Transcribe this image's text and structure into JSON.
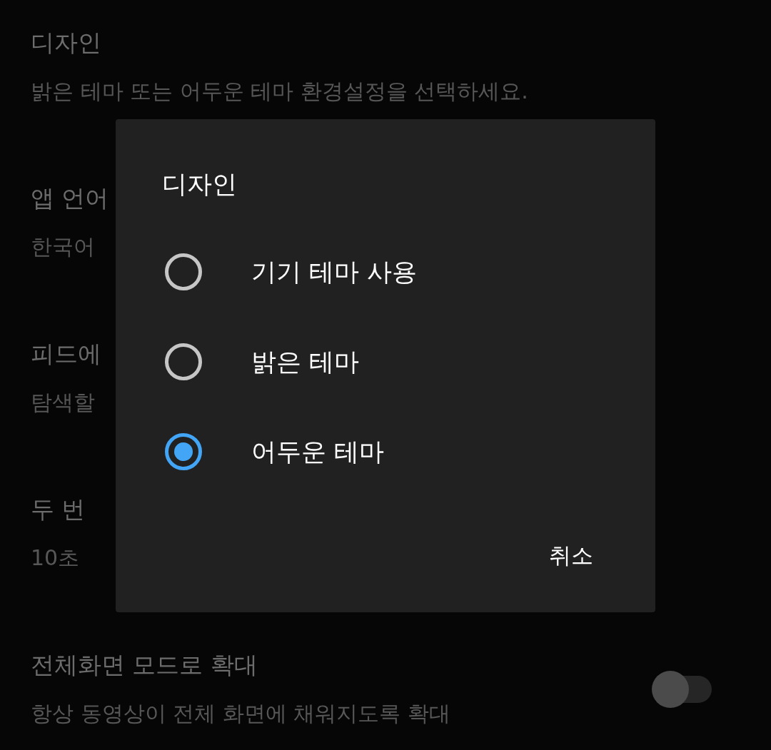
{
  "settings": [
    {
      "kind": "text",
      "title": "디자인",
      "subtitle": "밝은 테마 또는 어두운 테마 환경설정을 선택하세요."
    },
    {
      "kind": "text",
      "title": "앱 언어",
      "subtitle": "한국어"
    },
    {
      "kind": "text",
      "title": "피드에",
      "subtitle": "탐색할"
    },
    {
      "kind": "text",
      "title": "두 번",
      "subtitle": "10초"
    },
    {
      "kind": "toggle",
      "title": "전체화면 모드로 확대",
      "subtitle": "항상 동영상이 전체 화면에 채워지도록 확대",
      "switch": {
        "on": false
      }
    }
  ],
  "dialog": {
    "title": "디자인",
    "options": [
      {
        "label": "기기 테마 사용",
        "selected": false
      },
      {
        "label": "밝은 테마",
        "selected": false
      },
      {
        "label": "어두운 테마",
        "selected": true
      }
    ],
    "buttons": [
      "취소"
    ]
  }
}
